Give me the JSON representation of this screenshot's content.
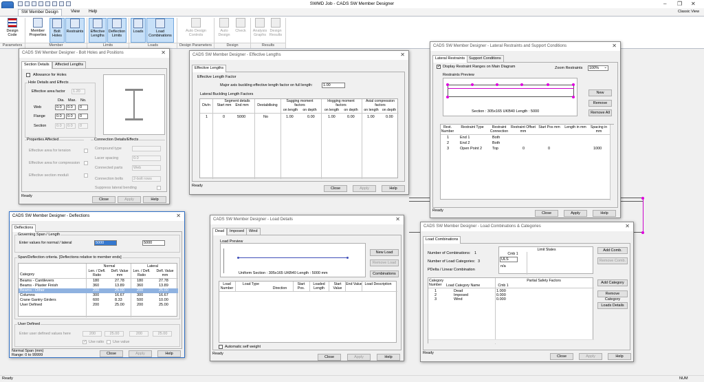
{
  "window": {
    "title": "SWMD Job - CADS SW Member Designer",
    "view_mode": "Classic View"
  },
  "ribbon": {
    "tabs": [
      "SW Member Design",
      "View",
      "Help"
    ],
    "buttons": {
      "design_code": "Design Code",
      "member_properties": "Member Properties",
      "bolt_holes": "Bolt Holes",
      "restraints": "Restraints",
      "effective_lengths": "Effective Lengths",
      "deflection_limits": "Deflection Limits",
      "loads": "Loads",
      "load_combinations": "Load Combinations",
      "auto_design_controls": "Auto Design Controls",
      "auto_design": "Auto Design",
      "check": "Check",
      "analysis_graphs": "Analysis Graphs",
      "design_results": "Design Results"
    },
    "groups": {
      "parameters": "Parameters",
      "member": "Member",
      "limits": "Limits",
      "loads": "Loads",
      "design_parameters": "Design Parameters",
      "design": "Design",
      "results": "Results"
    }
  },
  "bolt_dialog": {
    "title": "CADS SW Member Designer - Bolt Holes and Positions",
    "tabs": [
      "Section Details",
      "Affected Lengths"
    ],
    "allowance_label": "Allowance for Holes",
    "hole_details_title": "Hole Details and Effects",
    "eff_area_label": "Effective area factor",
    "eff_area_value": "1.20",
    "col_dia": "Dia.",
    "col_max": "Max.",
    "col_no": "No.",
    "rows": [
      {
        "label": "Web",
        "dia": "0.0",
        "max": "0.0",
        "no": "0"
      },
      {
        "label": "Flange",
        "dia": "0.0",
        "max": "0.0",
        "no": "0"
      },
      {
        "label": "Section",
        "dia": "0.0",
        "max": "0.0",
        "no": "0"
      }
    ],
    "props_title": "Properties Affected",
    "props": [
      "Effective area for tension",
      "Effective area for compression",
      "Effective section moduli"
    ],
    "conn_title": "Connection Details/Effects",
    "conn": [
      {
        "label": "Compound type",
        "value": ""
      },
      {
        "label": "Lacer spacing",
        "value": "0.0"
      },
      {
        "label": "Connected parts",
        "value": "Web"
      },
      {
        "label": "Connection bolts",
        "value": "2-bolt rows"
      }
    ],
    "suppress_label": "Suppress lateral bending",
    "status": "Ready",
    "close": "Close",
    "apply": "Apply",
    "help": "Help"
  },
  "efflen_dialog": {
    "title": "CADS SW Member Designer - Effective Lengths",
    "tab": "Effective Lengths",
    "factor_title": "Effective Length Factor",
    "factor_label": "Major axis buckling effective length factor on full length:",
    "factor_value": "1.00",
    "lateral_title": "Lateral Buckling Length Factors",
    "headers": {
      "divn": "Div/n",
      "segment": "Segment details",
      "start": "Start mm",
      "end": "End mm",
      "destab": "Destabilising",
      "sagging": "Sagging moment factors",
      "hogging": "Hogging moment factors",
      "axial": "Axial compression factors",
      "on_length": "on length",
      "on_depth": "on depth"
    },
    "rows": [
      {
        "divn": "1",
        "start": "0",
        "end": "5000",
        "destab": "No",
        "s1": "1.00",
        "s2": "0.00",
        "h1": "1.00",
        "h2": "0.00",
        "a1": "1.00",
        "a2": "0.00"
      }
    ],
    "status": "Ready",
    "close": "Close",
    "apply": "Apply",
    "help": "Help"
  },
  "restraint_dialog": {
    "title": "CADS SW Member Designer - Lateral Restraints and Support Conditions",
    "tabs": [
      "Lateral Restraints",
      "Support Conditions"
    ],
    "display_label": "Display Restraint Ranges on Main Diagram",
    "zoom_label": "Zoom Restraints",
    "zoom_value": "100%",
    "preview_title": "Restraints Preview",
    "section_label": "Section : 305x165 UKB40  Length : 5000",
    "new": "New",
    "remove": "Remove",
    "remove_all": "Remove All",
    "headers": {
      "number": "Rest. Number",
      "type": "Restraint Type",
      "connection": "Restraint Connection",
      "offset": "Restraint Offset mm",
      "start": "Start Pos mm",
      "length": "Length in mm",
      "spacing": "Spacing in mm"
    },
    "rows": [
      {
        "number": "1",
        "type": "End 1",
        "connection": "Both",
        "offset": "",
        "start": "",
        "length": "",
        "spacing": ""
      },
      {
        "number": "2",
        "type": "End 2",
        "connection": "Both",
        "offset": "",
        "start": "",
        "length": "",
        "spacing": ""
      },
      {
        "number": "3",
        "type": "Open Point 2",
        "connection": "Top",
        "offset": "0",
        "start": "0",
        "length": "",
        "spacing": "1000"
      }
    ],
    "status": "Ready",
    "close": "Close",
    "apply": "Apply",
    "help": "Help"
  },
  "defl_dialog": {
    "title": "CADS SW Member Designer - Deflections",
    "tab": "Deflections",
    "span_title": "Governing Span / Length",
    "span_label": "Enter values for normal / lateral",
    "span_normal": "5000",
    "span_lateral": "5000",
    "criteria_title": "Span/Deflection criteria. [Deflections relative to member ends]",
    "headers": {
      "category": "Category",
      "normal": "Normal",
      "lateral": "Lateral",
      "ratio": "Len. / Defl. Ratio",
      "value": "Defl. Value mm"
    },
    "rows": [
      {
        "cat": "Beams - Cantilevers",
        "nr": "180",
        "nv": "27.78",
        "lr": "180",
        "lv": "27.78"
      },
      {
        "cat": "Beams - Plaster Finish",
        "nr": "360",
        "nv": "13.89",
        "lr": "360",
        "lv": "13.89"
      },
      {
        "cat": "Beams - Other",
        "nr": "200",
        "nv": "25.00",
        "lr": "200",
        "lv": "25.00"
      },
      {
        "cat": "Columns",
        "nr": "300",
        "nv": "16.67",
        "lr": "300",
        "lv": "16.67"
      },
      {
        "cat": "Crane Gantry Girders",
        "nr": "600",
        "nv": "8.33",
        "lr": "500",
        "lv": "10.00"
      },
      {
        "cat": "User Defined",
        "nr": "200",
        "nv": "25.00",
        "lr": "200",
        "lv": "25.00"
      }
    ],
    "user_title": "User Defined",
    "user_label": "Enter user defined values here",
    "user_values": [
      "200",
      "25.00",
      "200",
      "25.00"
    ],
    "use_ratio": "Use ratio",
    "use_value": "Use value",
    "status_line1": "Normal Span (mm)",
    "status_line2": "Range: 0 to 99999",
    "close": "Close",
    "apply": "Apply",
    "help": "Help"
  },
  "load_dialog": {
    "title": "CADS SW Member Designer - Load Details",
    "tabs": [
      "Dead",
      "Imposed",
      "Wind"
    ],
    "preview_title": "Load Preview",
    "preview_label": "Uniform  Section : 305x165 UKB40  Length : 5000 mm",
    "new_load": "New Load",
    "remove_load": "Remove Load",
    "combinations": "Combinations",
    "headers": [
      "Load Number",
      "Load Type",
      "Direction",
      "Start Pos.",
      "Loaded Length",
      "Start Value",
      "End Value",
      "Load Description"
    ],
    "self_weight": "Automatic self weight",
    "status": "Ready",
    "close": "Close",
    "apply": "Apply",
    "help": "Help"
  },
  "combo_dialog": {
    "title": "CADS SW Member Designer - Load Combinations & Categories",
    "tab": "Load Combinations",
    "num_comb_label": "Number of Combinations:",
    "num_comb": "1",
    "num_cat_label": "Number of Load Categories:",
    "num_cat": "3",
    "pdelta_label": "PDelta / Linear Combination",
    "limit_states": "Limit States",
    "cmb_col": "Cmb 1",
    "uls": "ULS",
    "na": "n/a",
    "add_comb": "Add Comb.",
    "remove_comb": "Remove Comb.",
    "add_cat": "Add Category",
    "remove_cat": "Remove Category",
    "loads_details": "Loads Details",
    "cat_headers": {
      "cat": "Category Number",
      "name": "Load Category Name",
      "psf": "Partial Safety Factors",
      "cmb": "Cmb 1"
    },
    "cats": [
      {
        "n": "1",
        "name": "Dead",
        "v": "1.000"
      },
      {
        "n": "2",
        "name": "Imposed",
        "v": "0.000"
      },
      {
        "n": "3",
        "name": "Wind",
        "v": "0.000"
      }
    ],
    "status": "Ready",
    "close": "Close",
    "apply": "Apply",
    "help": "Help"
  },
  "statusbar": {
    "left": "Ready",
    "right": "NUM"
  }
}
